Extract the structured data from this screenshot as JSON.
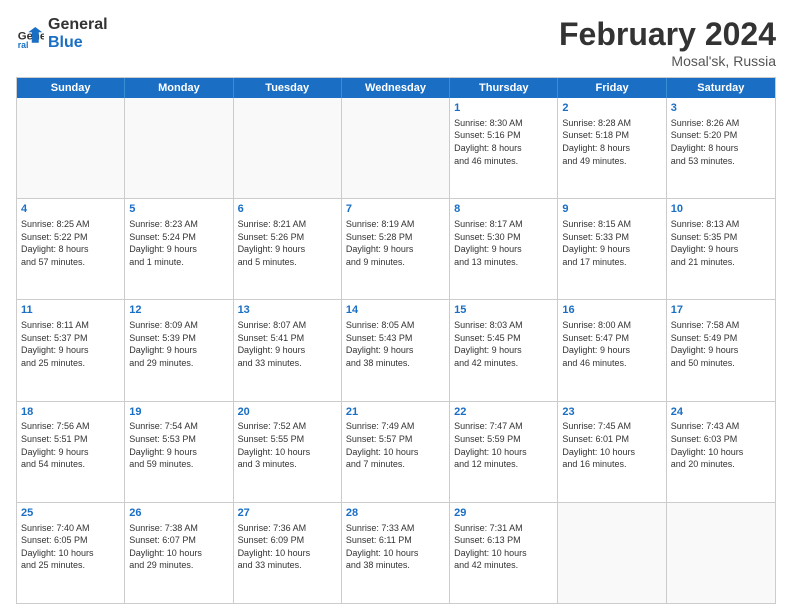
{
  "header": {
    "logo_line1": "General",
    "logo_line2": "Blue",
    "month": "February 2024",
    "location": "Mosal'sk, Russia"
  },
  "weekdays": [
    "Sunday",
    "Monday",
    "Tuesday",
    "Wednesday",
    "Thursday",
    "Friday",
    "Saturday"
  ],
  "rows": [
    [
      {
        "day": "",
        "text": ""
      },
      {
        "day": "",
        "text": ""
      },
      {
        "day": "",
        "text": ""
      },
      {
        "day": "",
        "text": ""
      },
      {
        "day": "1",
        "text": "Sunrise: 8:30 AM\nSunset: 5:16 PM\nDaylight: 8 hours\nand 46 minutes."
      },
      {
        "day": "2",
        "text": "Sunrise: 8:28 AM\nSunset: 5:18 PM\nDaylight: 8 hours\nand 49 minutes."
      },
      {
        "day": "3",
        "text": "Sunrise: 8:26 AM\nSunset: 5:20 PM\nDaylight: 8 hours\nand 53 minutes."
      }
    ],
    [
      {
        "day": "4",
        "text": "Sunrise: 8:25 AM\nSunset: 5:22 PM\nDaylight: 8 hours\nand 57 minutes."
      },
      {
        "day": "5",
        "text": "Sunrise: 8:23 AM\nSunset: 5:24 PM\nDaylight: 9 hours\nand 1 minute."
      },
      {
        "day": "6",
        "text": "Sunrise: 8:21 AM\nSunset: 5:26 PM\nDaylight: 9 hours\nand 5 minutes."
      },
      {
        "day": "7",
        "text": "Sunrise: 8:19 AM\nSunset: 5:28 PM\nDaylight: 9 hours\nand 9 minutes."
      },
      {
        "day": "8",
        "text": "Sunrise: 8:17 AM\nSunset: 5:30 PM\nDaylight: 9 hours\nand 13 minutes."
      },
      {
        "day": "9",
        "text": "Sunrise: 8:15 AM\nSunset: 5:33 PM\nDaylight: 9 hours\nand 17 minutes."
      },
      {
        "day": "10",
        "text": "Sunrise: 8:13 AM\nSunset: 5:35 PM\nDaylight: 9 hours\nand 21 minutes."
      }
    ],
    [
      {
        "day": "11",
        "text": "Sunrise: 8:11 AM\nSunset: 5:37 PM\nDaylight: 9 hours\nand 25 minutes."
      },
      {
        "day": "12",
        "text": "Sunrise: 8:09 AM\nSunset: 5:39 PM\nDaylight: 9 hours\nand 29 minutes."
      },
      {
        "day": "13",
        "text": "Sunrise: 8:07 AM\nSunset: 5:41 PM\nDaylight: 9 hours\nand 33 minutes."
      },
      {
        "day": "14",
        "text": "Sunrise: 8:05 AM\nSunset: 5:43 PM\nDaylight: 9 hours\nand 38 minutes."
      },
      {
        "day": "15",
        "text": "Sunrise: 8:03 AM\nSunset: 5:45 PM\nDaylight: 9 hours\nand 42 minutes."
      },
      {
        "day": "16",
        "text": "Sunrise: 8:00 AM\nSunset: 5:47 PM\nDaylight: 9 hours\nand 46 minutes."
      },
      {
        "day": "17",
        "text": "Sunrise: 7:58 AM\nSunset: 5:49 PM\nDaylight: 9 hours\nand 50 minutes."
      }
    ],
    [
      {
        "day": "18",
        "text": "Sunrise: 7:56 AM\nSunset: 5:51 PM\nDaylight: 9 hours\nand 54 minutes."
      },
      {
        "day": "19",
        "text": "Sunrise: 7:54 AM\nSunset: 5:53 PM\nDaylight: 9 hours\nand 59 minutes."
      },
      {
        "day": "20",
        "text": "Sunrise: 7:52 AM\nSunset: 5:55 PM\nDaylight: 10 hours\nand 3 minutes."
      },
      {
        "day": "21",
        "text": "Sunrise: 7:49 AM\nSunset: 5:57 PM\nDaylight: 10 hours\nand 7 minutes."
      },
      {
        "day": "22",
        "text": "Sunrise: 7:47 AM\nSunset: 5:59 PM\nDaylight: 10 hours\nand 12 minutes."
      },
      {
        "day": "23",
        "text": "Sunrise: 7:45 AM\nSunset: 6:01 PM\nDaylight: 10 hours\nand 16 minutes."
      },
      {
        "day": "24",
        "text": "Sunrise: 7:43 AM\nSunset: 6:03 PM\nDaylight: 10 hours\nand 20 minutes."
      }
    ],
    [
      {
        "day": "25",
        "text": "Sunrise: 7:40 AM\nSunset: 6:05 PM\nDaylight: 10 hours\nand 25 minutes."
      },
      {
        "day": "26",
        "text": "Sunrise: 7:38 AM\nSunset: 6:07 PM\nDaylight: 10 hours\nand 29 minutes."
      },
      {
        "day": "27",
        "text": "Sunrise: 7:36 AM\nSunset: 6:09 PM\nDaylight: 10 hours\nand 33 minutes."
      },
      {
        "day": "28",
        "text": "Sunrise: 7:33 AM\nSunset: 6:11 PM\nDaylight: 10 hours\nand 38 minutes."
      },
      {
        "day": "29",
        "text": "Sunrise: 7:31 AM\nSunset: 6:13 PM\nDaylight: 10 hours\nand 42 minutes."
      },
      {
        "day": "",
        "text": ""
      },
      {
        "day": "",
        "text": ""
      }
    ]
  ]
}
